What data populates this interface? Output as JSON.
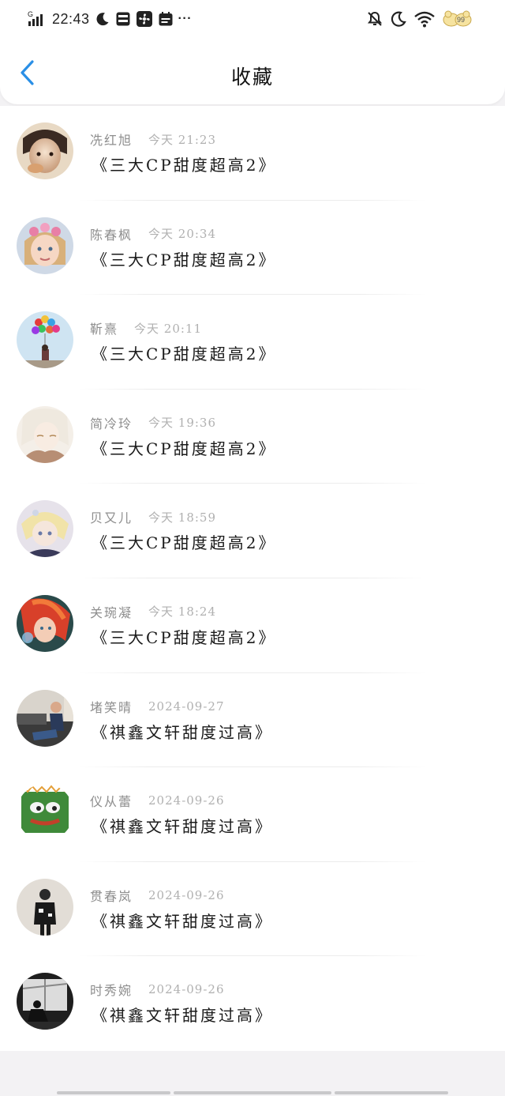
{
  "status_bar": {
    "carrier": "G",
    "time": "22:43",
    "more": "···"
  },
  "header": {
    "title": "收藏",
    "back_icon": "chevron-left-icon"
  },
  "favorites": [
    {
      "name": "冼红旭",
      "time": "今天 21:23",
      "title": "《三大CP甜度超高2》",
      "avatar": "child-portrait"
    },
    {
      "name": "陈春枫",
      "time": "今天 20:34",
      "title": "《三大CP甜度超高2》",
      "avatar": "girl-flower-crown"
    },
    {
      "name": "靳熹",
      "time": "今天 20:11",
      "title": "《三大CP甜度超高2》",
      "avatar": "balloons"
    },
    {
      "name": "简冷玲",
      "time": "今天 19:36",
      "title": "《三大CP甜度超高2》",
      "avatar": "anime-white-hair"
    },
    {
      "name": "贝又儿",
      "time": "今天 18:59",
      "title": "《三大CP甜度超高2》",
      "avatar": "anime-blond"
    },
    {
      "name": "关琬凝",
      "time": "今天 18:24",
      "title": "《三大CP甜度超高2》",
      "avatar": "anime-red-hair"
    },
    {
      "name": "堵笑晴",
      "time": "2024-09-27",
      "title": "《祺鑫文轩甜度过高》",
      "avatar": "man-on-sofa"
    },
    {
      "name": "仪从蕾",
      "time": "2024-09-26",
      "title": "《祺鑫文轩甜度过高》",
      "avatar": "green-frog"
    },
    {
      "name": "贯春岚",
      "time": "2024-09-26",
      "title": "《祺鑫文轩甜度过高》",
      "avatar": "man-black-outfit"
    },
    {
      "name": "时秀婉",
      "time": "2024-09-26",
      "title": "《祺鑫文轩甜度过高》",
      "avatar": "window-silhouette"
    }
  ],
  "colors": {
    "accent": "#2a8fe6",
    "name_text": "#8e8e8e",
    "time_text": "#b0b0b0",
    "title_text": "#1a1a1a",
    "background": "#f3f2f4"
  }
}
